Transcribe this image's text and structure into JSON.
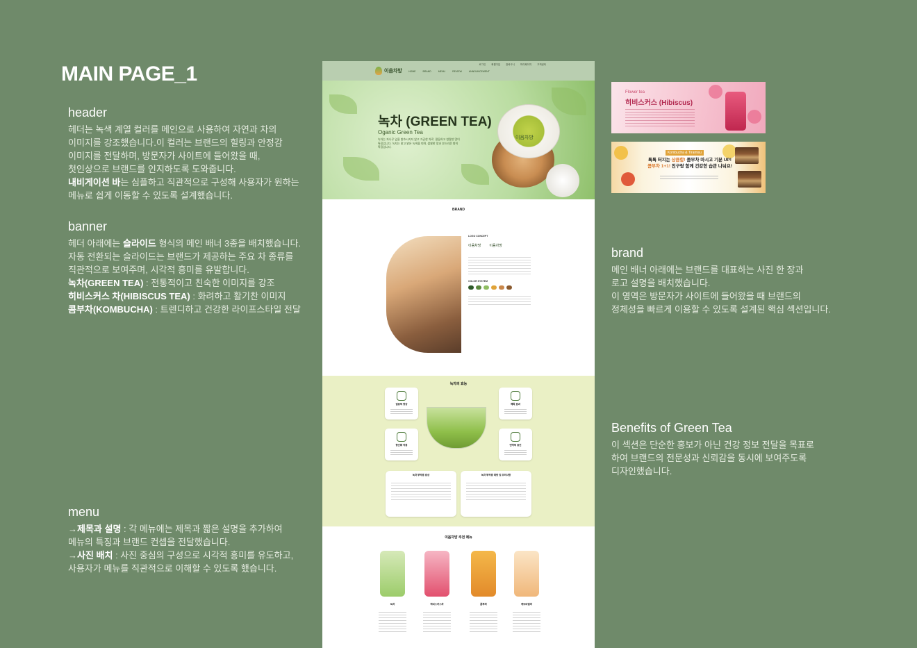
{
  "page_title": "MAIN PAGE_1",
  "descriptions": {
    "header": {
      "heading": "header",
      "body": "헤더는 녹색 계열 컬러를 메인으로 사용하여 자연과 차의\n이미지를 강조했습니다.이  컬러는 브랜드의 힐링과 안정감\n이미지를 전달하며, 방문자가 사이트에 들어왔을 때,\n첫인상으로 브랜드를  인지하도록 도와줍니다.",
      "nav_bold": "내비게이션 바",
      "nav_rest": "는 심플하고 직관적으로 구성해 사용자가 원하는\n 메뉴로 쉽게 이동할 수 있도록 설계했습니다."
    },
    "banner": {
      "heading": "banner",
      "line1_a": "헤더 아래에는 ",
      "line1_bold": "슬라이드",
      "line1_b": " 형식의 메인 배너 3종을 배치했습니다.",
      "line2": "자동 전환되는 슬라이드는 브랜드가 제공하는 주요 차 종류를\n직관적으로 보여주며,  시각적 흥미를 유발합니다.",
      "item1_bold": "녹차(GREEN TEA)",
      "item1_rest": " : 전통적이고 친숙한 이미지를 강조",
      "item2_bold": "히비스커스 차(HIBISCUS TEA)",
      "item2_rest": " : 화려하고 활기찬 이미지",
      "item3_bold": "콤부차(KOMBUCHA)",
      "item3_rest": " : 트렌디하고 건강한 라이프스타일 전달"
    },
    "menu": {
      "heading": "menu",
      "item1_prefix": "→",
      "item1_bold": "제목과 설명",
      "item1_rest": " : 각 메뉴에는 제목과 짧은 설명을 추가하여\n 메뉴의 특징과 브랜드 컨셉을 전달했습니다.",
      "item2_prefix": "→",
      "item2_bold": "사진 배치",
      "item2_rest": " : 사진 중심의 구성으로 시각적 흥미를 유도하고,\n사용자가 메뉴를 직관적으로 이해할 수 있도록 했습니다."
    },
    "brand": {
      "heading": "brand",
      "body": "메인 배너 아래에는 브랜드를 대표하는 사진 한 장과\n로고 설명을 배치했습니다.\n이 영역은 방문자가 사이트에 들어왔을 때 브랜드의\n정체성을 빠르게 이용할 수 있도록 설계된 핵심 섹션입니다."
    },
    "benefits": {
      "heading": "Benefits of Green Tea",
      "body": "이 섹션은 단순한 홍보가 아닌 건강 정보 전달을 목표로\n하여 브랜드의 전문성과 신뢰감을 동시에 보여주도록\n디자인했습니다."
    }
  },
  "mockup": {
    "nav": {
      "logo_text": "이음차방",
      "menu": [
        "HOME",
        "BRAND",
        "MENU",
        "REVIEW",
        "ANNOUNCEMENT"
      ],
      "util": [
        "로그인",
        "회원가입",
        "장바구니",
        "마이페이지",
        "고객센터"
      ]
    },
    "hero": {
      "title": "녹차 (GREEN TEA)",
      "subtitle": "Oganic Green Tea",
      "text": "녹차는 자나무 잎을 발효시키지 않고 가공한 차로, 깔끔하고 청량한 맛이 특징입니다. 녹차는 맑고 밝은 녹색을 띠며, 쌉쌀한 맛과 부드러운 향이 특징입니다.",
      "cup_label": "이음차방"
    },
    "brand": {
      "title": "BRAND",
      "logo_concept": "LOGO CONCEPT",
      "logo_a": "이음차방",
      "logo_b": "이음차방",
      "color_system": "COLOR SYSTEM"
    },
    "benefits": {
      "title": "녹차의 효능",
      "cards": [
        "집중력 향상",
        "해독 효과",
        "항산화 작용",
        "면역력 증진"
      ],
      "box_left": "녹차 부작용 증상",
      "box_right": "녹차 부작용 예방 및 주의사항"
    },
    "menu": {
      "title": "이음차방 추천 메뉴",
      "items": [
        "녹차",
        "히비스커스차",
        "콤부차",
        "캐모마일차"
      ]
    }
  },
  "banners": {
    "hibiscus": {
      "tag": "Flower tea",
      "title": "히비스커스 (Hibiscus)"
    },
    "kombucha": {
      "tag": "Kombucha & Tiramisu",
      "line1_a": "톡톡 터지는 ",
      "line1_em": "상큼함!",
      "line1_b": " 콤부차 마시고 기분 UP!",
      "line2_em": "콤부차 1+1!",
      "line2_b": " 친구랑 함께 건강한 습관 나눠요!"
    }
  },
  "colors": {
    "background": "#6f8a6a",
    "nav_green": "#b9ceb0",
    "benefits_bg": "#eaf0c5",
    "accent_hibiscus": "#b2284f",
    "accent_kombucha": "#d9782d"
  }
}
